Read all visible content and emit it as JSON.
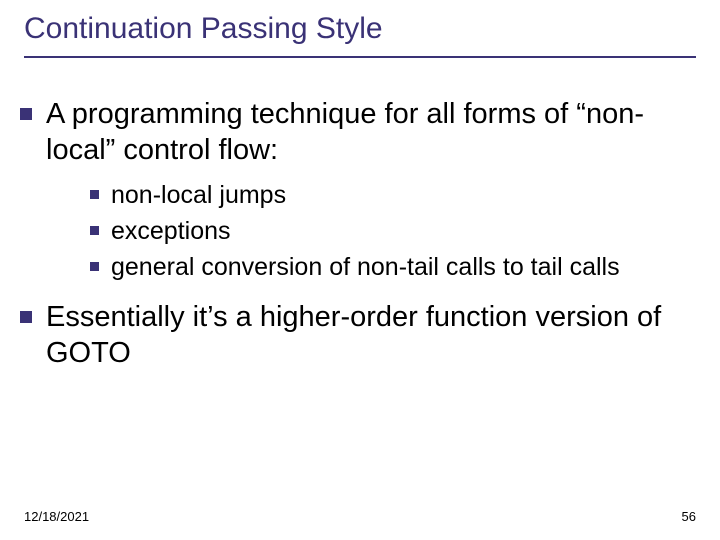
{
  "title": "Continuation Passing Style",
  "points": {
    "p1": "A programming technique for all forms of “non-local” control flow:",
    "sub": [
      "non-local jumps",
      "exceptions",
      "general conversion of non-tail calls to tail calls"
    ],
    "p2": "Essentially it’s a higher-order function version of GOTO"
  },
  "footer": {
    "date": "12/18/2021",
    "page": "56"
  }
}
